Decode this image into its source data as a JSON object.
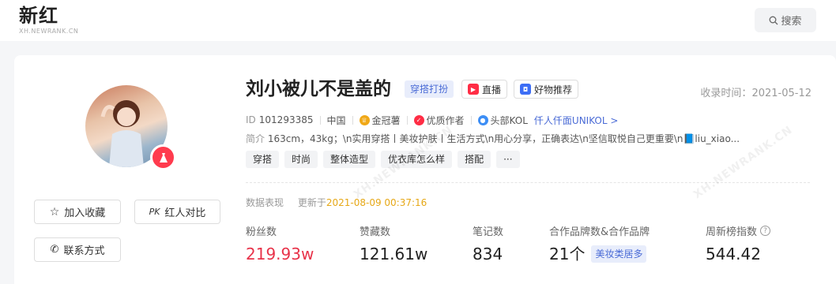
{
  "header": {
    "logo_text": "新红",
    "logo_sub": "XH.NEWRANK.CN",
    "search_label": "搜索"
  },
  "profile": {
    "name": "刘小被儿不是盖的",
    "category_tag": "穿搭打扮",
    "pills": [
      {
        "label": "直播",
        "icon": "live-icon",
        "color": "#ff2d45"
      },
      {
        "label": "好物推荐",
        "icon": "shop-bag-icon",
        "color": "#3d6ef5"
      }
    ],
    "record_label": "收录时间：",
    "record_date": "2021-05-12",
    "id_label": "ID",
    "id_value": "101293385",
    "region": "中国",
    "badges": [
      {
        "label": "金冠薯",
        "icon": "gold-crown-icon",
        "color": "#f0a817"
      },
      {
        "label": "优质作者",
        "icon": "quality-author-icon",
        "color": "#ff2d45"
      },
      {
        "label": "头部KOL",
        "icon": "top-kol-icon",
        "color": "#3d8ef5"
      }
    ],
    "link_text": "仟人仟面UNIKOL >",
    "bio_label": "简介",
    "bio_text": "163cm，43kg；\\n实用穿搭丨美妆护肤丨生活方式\\n用心分享，正确表达\\n坚信取悦自己更重要\\n📘liu_xiao...",
    "tags": [
      "穿搭",
      "时尚",
      "整体造型",
      "优衣库怎么样",
      "搭配",
      "···"
    ]
  },
  "actions": {
    "favorite_label": "加入收藏",
    "compare_prefix": "PK",
    "compare_label": "红人对比",
    "contact_label": "联系方式"
  },
  "performance": {
    "title": "数据表现",
    "updated_label": "更新于",
    "updated_time": "2021-08-09 00:37:16",
    "stats": [
      {
        "label": "粉丝数",
        "value": "219.93w"
      },
      {
        "label": "赞藏数",
        "value": "121.61w"
      },
      {
        "label": "笔记数",
        "value": "834"
      },
      {
        "label": "合作品牌数&合作品牌",
        "value": "21个",
        "tag": "美妆类居多"
      },
      {
        "label": "周新榜指数",
        "value": "544.42",
        "help": "?"
      }
    ]
  },
  "watermark": "XH.NEWRANK.CN",
  "colors": {
    "accent_red": "#e8334a",
    "accent_blue": "#4a6bd6",
    "timestamp": "#e6a817"
  }
}
